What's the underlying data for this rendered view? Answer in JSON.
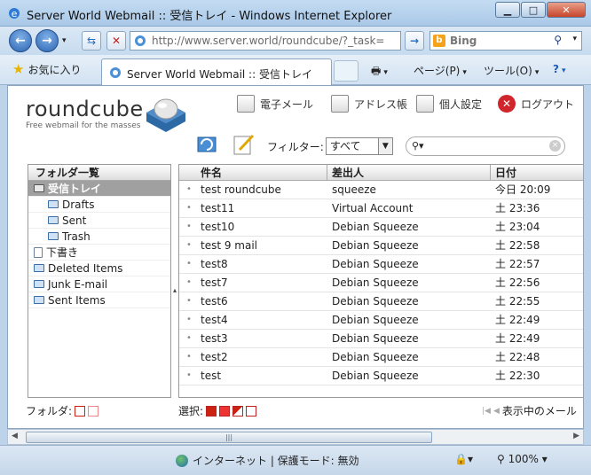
{
  "window": {
    "title": "Server World Webmail :: 受信トレイ - Windows Internet Explorer",
    "minimize_icon": "minimize-icon",
    "maximize_icon": "maximize-icon",
    "close_icon": "close-icon"
  },
  "address_bar": {
    "url": "http://www.server.world/roundcube/?_task=",
    "search_placeholder": "Bing"
  },
  "tab_bar": {
    "favorites_label": "お気に入り",
    "active_tab_label": "Server World Webmail :: 受信トレイ",
    "page_menu": "ページ(P)",
    "tools_menu": "ツール(O)"
  },
  "app": {
    "logo_text": "roundcube",
    "logo_tagline": "Free webmail for the masses",
    "nav": {
      "mail": "電子メール",
      "addressbook": "アドレス帳",
      "settings": "個人設定",
      "logout": "ログアウト"
    },
    "filter": {
      "label": "フィルター:",
      "selected": "すべて"
    }
  },
  "folders": {
    "header": "フォルダ一覧",
    "items": [
      {
        "label": "受信トレイ",
        "selected": true
      },
      {
        "label": "Drafts"
      },
      {
        "label": "Sent"
      },
      {
        "label": "Trash"
      },
      {
        "label": "下書き"
      },
      {
        "label": "Deleted Items"
      },
      {
        "label": "Junk E-mail"
      },
      {
        "label": "Sent Items"
      }
    ],
    "footer_label": "フォルダ:"
  },
  "messages": {
    "columns": {
      "subject": "件名",
      "from": "差出人",
      "date": "日付"
    },
    "rows": [
      {
        "subject": "test roundcube",
        "from": "squeeze",
        "date": "今日 20:09"
      },
      {
        "subject": "test11",
        "from": "Virtual Account",
        "date": "土 23:36"
      },
      {
        "subject": "test10",
        "from": "Debian Squeeze",
        "date": "土 23:04"
      },
      {
        "subject": "test 9 mail",
        "from": "Debian Squeeze",
        "date": "土 22:58"
      },
      {
        "subject": "test8",
        "from": "Debian Squeeze",
        "date": "土 22:57"
      },
      {
        "subject": "test7",
        "from": "Debian Squeeze",
        "date": "土 22:56"
      },
      {
        "subject": "test6",
        "from": "Debian Squeeze",
        "date": "土 22:55"
      },
      {
        "subject": "test4",
        "from": "Debian Squeeze",
        "date": "土 22:49"
      },
      {
        "subject": "test3",
        "from": "Debian Squeeze",
        "date": "土 22:49"
      },
      {
        "subject": "test2",
        "from": "Debian Squeeze",
        "date": "土 22:48"
      },
      {
        "subject": "test",
        "from": "Debian Squeeze",
        "date": "土 22:30"
      }
    ],
    "select_label": "選択:",
    "paging_label": "表示中のメール"
  },
  "status_bar": {
    "zone_text": "インターネット | 保護モード: 無効",
    "zoom": "100%"
  }
}
